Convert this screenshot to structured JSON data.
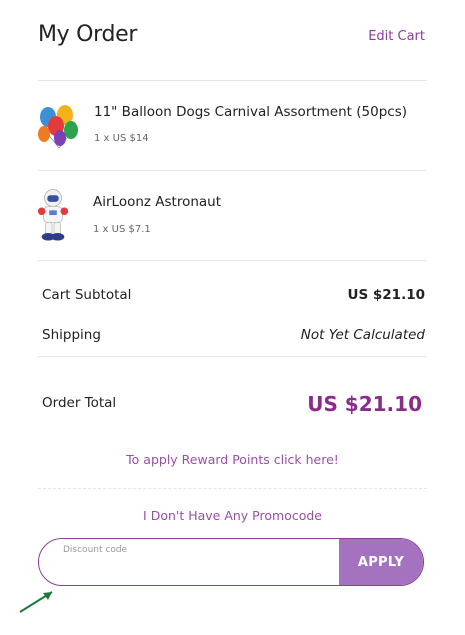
{
  "header": {
    "title": "My Order",
    "edit_cart": "Edit Cart"
  },
  "items": [
    {
      "name": "11\" Balloon Dogs Carnival Assortment (50pcs)",
      "meta": "1 x US $14",
      "icon": "balloon-dogs-thumbnail"
    },
    {
      "name": "AirLoonz Astronaut",
      "meta": "1 x US $7.1",
      "icon": "astronaut-balloon-thumbnail"
    }
  ],
  "summary": {
    "subtotal_label": "Cart Subtotal",
    "subtotal_value": "US $21.10",
    "shipping_label": "Shipping",
    "shipping_value": "Not Yet Calculated",
    "total_label": "Order Total",
    "total_value": "US $21.10"
  },
  "reward_link": "To apply Reward Points click here!",
  "promo_link": "I Don't Have Any Promocode",
  "discount": {
    "label": "Discount code",
    "value": "",
    "apply_label": "APPLY"
  },
  "colors": {
    "accent": "#8a3f96",
    "button": "#a472be",
    "total": "#8a2c8a",
    "arrow": "#1e7a3c"
  }
}
